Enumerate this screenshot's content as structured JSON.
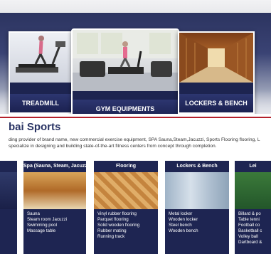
{
  "header": {
    "faded_text": ""
  },
  "carousel": {
    "slides": [
      {
        "label": "TREADMILL"
      },
      {
        "label": "GYM EQUIPMENTS"
      },
      {
        "label": "LOCKERS & BENCH"
      }
    ]
  },
  "section": {
    "title": "bai Sports",
    "description_line1": "ding provider of brand name, new commercial exercise equipment, SPA Sauna,Steam,Jacuzzi, Sports Flooring flooring, L",
    "description_line2": "specialize in designing and building state-of-the-art fitness centers from concept through completion."
  },
  "categories": [
    {
      "key": "spa",
      "title": "Spa (Sauna, Steam, Jacuzzi)",
      "items": [
        "Sauna",
        "Steam room Jacuzzi",
        "Swimming pool",
        "Massage table"
      ]
    },
    {
      "key": "flooring",
      "title": "Flooring",
      "items": [
        "Vinyl rubber flooring",
        "Parquet flooring",
        "Solid wooden flooring",
        "Rubber mating",
        "Running track"
      ]
    },
    {
      "key": "lockers",
      "title": "Lockers & Bench",
      "items": [
        "Metal locker",
        "Wooden locker",
        "Steel bench",
        "Wooden bench"
      ]
    },
    {
      "key": "leisure",
      "title": "Lei",
      "items": [
        "Billard & po",
        "Table tenni",
        "Football co",
        "Basketball c",
        "Volley ball",
        "Dartboard &"
      ]
    }
  ]
}
